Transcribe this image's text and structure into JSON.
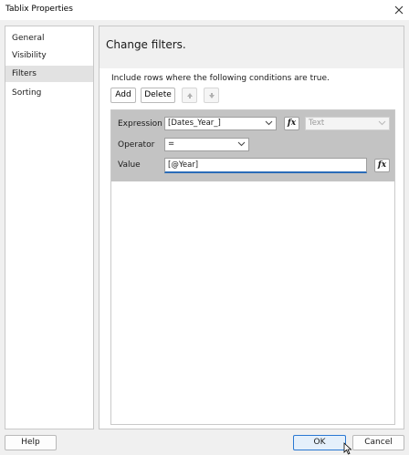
{
  "window": {
    "title": "Tablix Properties",
    "close_icon": "close-icon"
  },
  "nav": {
    "items": [
      {
        "label": "General",
        "selected": false
      },
      {
        "label": "Visibility",
        "selected": false
      },
      {
        "label": "Filters",
        "selected": true
      },
      {
        "label": "Sorting",
        "selected": false
      }
    ]
  },
  "content": {
    "title": "Change filters.",
    "instruction": "Include rows where the following conditions are true.",
    "buttons": {
      "add": "Add",
      "delete": "Delete",
      "move_up_icon": "arrow-up-icon",
      "move_down_icon": "arrow-down-icon"
    },
    "filter": {
      "expression_label": "Expression",
      "expression_value": "[Dates_Year_]",
      "fx_icon": "function-icon",
      "fx_glyph": "fx",
      "type_value": "Text",
      "operator_label": "Operator",
      "operator_value": "=",
      "value_label": "Value",
      "value_value": "[@Year]"
    }
  },
  "footer": {
    "help": "Help",
    "ok": "OK",
    "cancel": "Cancel"
  },
  "colors": {
    "selected_nav": "#e2e2e2",
    "filter_row": "#c3c3c3",
    "accent": "#2a78d2"
  }
}
